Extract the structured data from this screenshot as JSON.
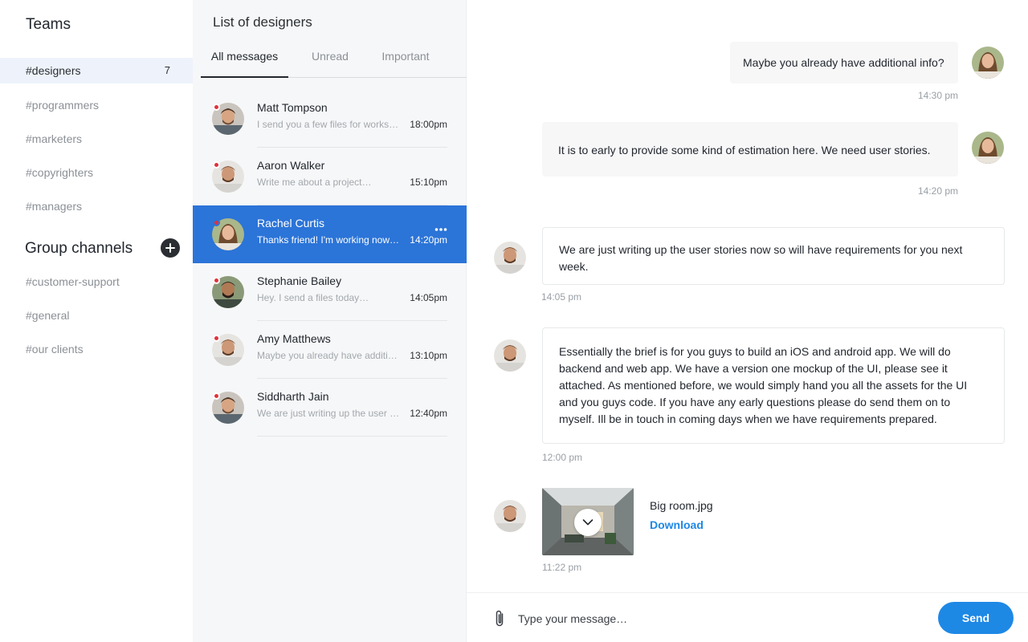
{
  "sidebar": {
    "teams_heading": "Teams",
    "teams": [
      {
        "label": "#designers",
        "count": "7"
      },
      {
        "label": "#programmers"
      },
      {
        "label": "#marketers"
      },
      {
        "label": "#copyrighters"
      },
      {
        "label": "#managers"
      }
    ],
    "group_heading": "Group channels",
    "groups": [
      {
        "label": "#customer-support"
      },
      {
        "label": "#general"
      },
      {
        "label": "#our clients"
      }
    ]
  },
  "list": {
    "title": "List of designers",
    "tabs": [
      {
        "label": "All messages",
        "active": true
      },
      {
        "label": "Unread"
      },
      {
        "label": "Important"
      }
    ],
    "conversations": [
      {
        "name": "Matt Tompson",
        "preview": "I send you a few files for workshop",
        "time": "18:00pm"
      },
      {
        "name": "Aaron Walker",
        "preview": "Write me about a project…",
        "time": "15:10pm"
      },
      {
        "name": "Rachel Curtis",
        "preview": "Thanks friend! I'm working now on the project",
        "time": "14:20pm",
        "selected": true
      },
      {
        "name": "Stephanie Bailey",
        "preview": "Hey. I send a files today…",
        "time": "14:05pm"
      },
      {
        "name": "Amy Matthews",
        "preview": "Maybe you already have additional info?",
        "time": "13:10pm"
      },
      {
        "name": "Siddharth Jain",
        "preview": "We are just writing up the user stories",
        "time": "12:40pm"
      }
    ]
  },
  "chat": {
    "messages": [
      {
        "text": "Maybe you already have additional info?",
        "time": "14:30 pm"
      },
      {
        "text": "It is to early to provide some kind of estimation here. We need user stories.",
        "time": "14:20 pm"
      },
      {
        "text": "We are just writing up the user stories now so will have requirements for you next week.",
        "time": "14:05 pm"
      },
      {
        "text": "Essentially the brief is for you guys to build an iOS and android app. We will do backend and web app. We have a version one mockup of the UI, please see it attached. As mentioned before, we would simply hand you all the assets for the UI and you guys code. If you have any early questions please do send them on to myself. Ill be in touch in coming days when we have requirements prepared.",
        "time": "12:00 pm"
      }
    ],
    "attachment": {
      "file_name": "Big room.jpg",
      "download_label": "Download",
      "time": "11:22 pm"
    },
    "composer": {
      "placeholder": "Type your message…",
      "send_label": "Send"
    }
  },
  "colors": {
    "accent": "#1e88e5",
    "selected_row": "#2b74d8",
    "unread_dot": "#e2313b"
  }
}
